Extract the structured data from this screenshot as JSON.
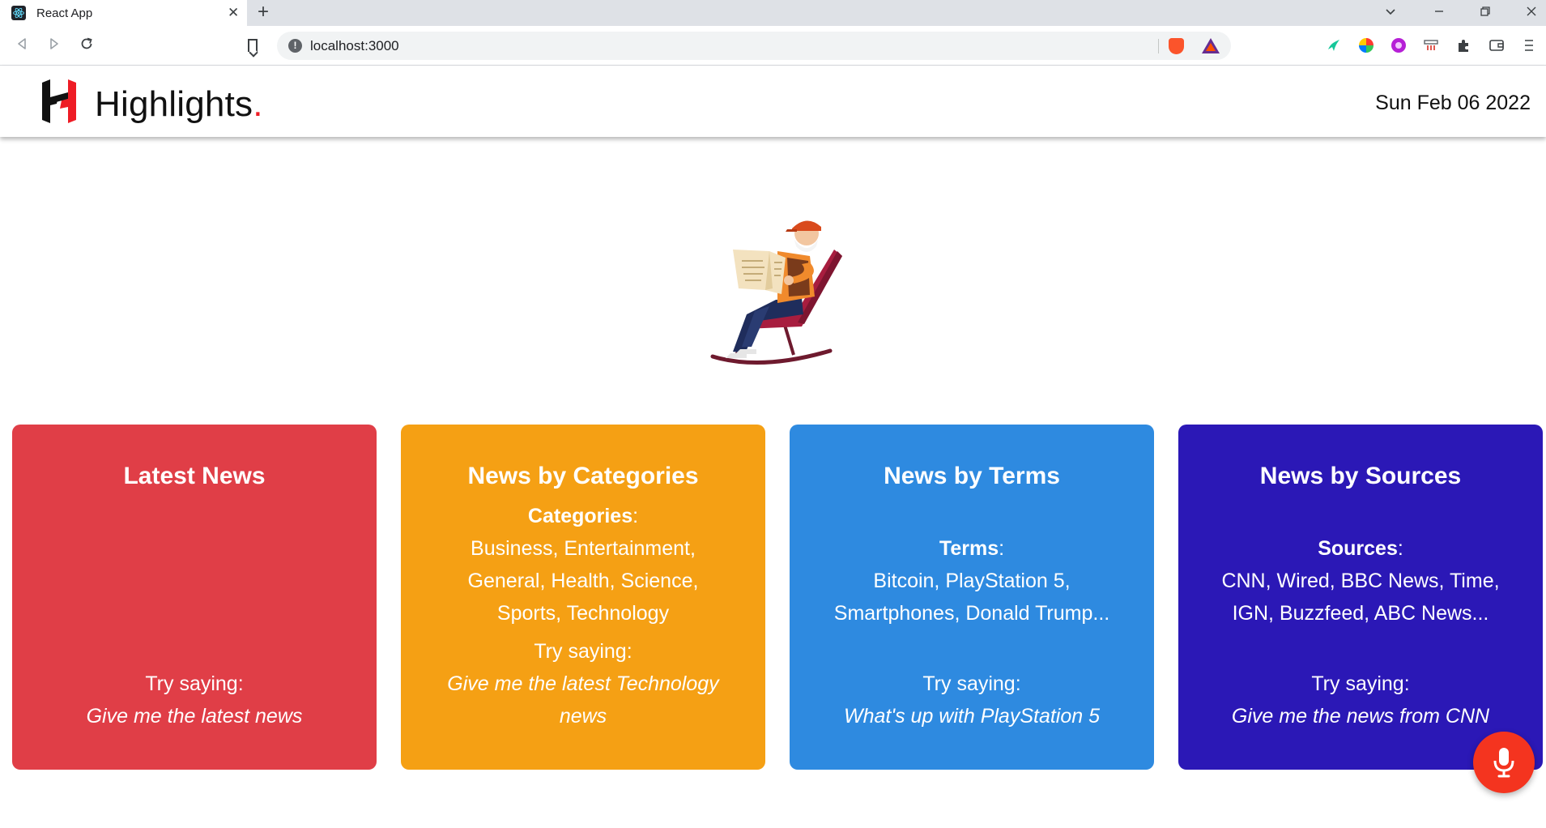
{
  "browser": {
    "tab_title": "React App",
    "tab_close": "✕",
    "new_tab": "+",
    "url": "localhost:3000",
    "window_controls": {
      "dropdown": "⌄",
      "minimize": "—",
      "restore": "❐",
      "close": "✕"
    }
  },
  "header": {
    "brand_name": "Highlights",
    "brand_dot": ".",
    "date": "Sun Feb 06 2022"
  },
  "cards": [
    {
      "title": "Latest News",
      "color": "#e03e47",
      "info_label": "",
      "info_sep": "",
      "info_lines": [],
      "try_label": "Try saying:",
      "try_example": "Give me the latest news"
    },
    {
      "title": "News by Categories",
      "color": "#f5a014",
      "info_label": "Categories",
      "info_sep": ":",
      "info_lines": [
        "Business, Entertainment,",
        "General, Health, Science,",
        "Sports, Technology"
      ],
      "try_label": "Try saying:",
      "try_example": "Give me the latest Technology news"
    },
    {
      "title": "News by Terms",
      "color": "#2e8ae0",
      "info_label": "Terms",
      "info_sep": ":",
      "info_lines": [
        "Bitcoin, PlayStation 5,",
        "Smartphones, Donald Trump..."
      ],
      "try_label": "Try saying:",
      "try_example": "What's up with PlayStation 5"
    },
    {
      "title": "News by Sources",
      "color": "#2b18b6",
      "info_label": "Sources",
      "info_sep": ":",
      "info_lines": [
        "CNN, Wired, BBC News, Time,",
        "IGN, Buzzfeed, ABC News..."
      ],
      "try_label": "Try saying:",
      "try_example": "Give me the news from CNN"
    }
  ],
  "colors": {
    "brand_accent": "#ee1c25",
    "mic_button": "#f4341f"
  },
  "icons": {
    "mic": "microphone-icon",
    "logo": "highlights-h-logo"
  }
}
